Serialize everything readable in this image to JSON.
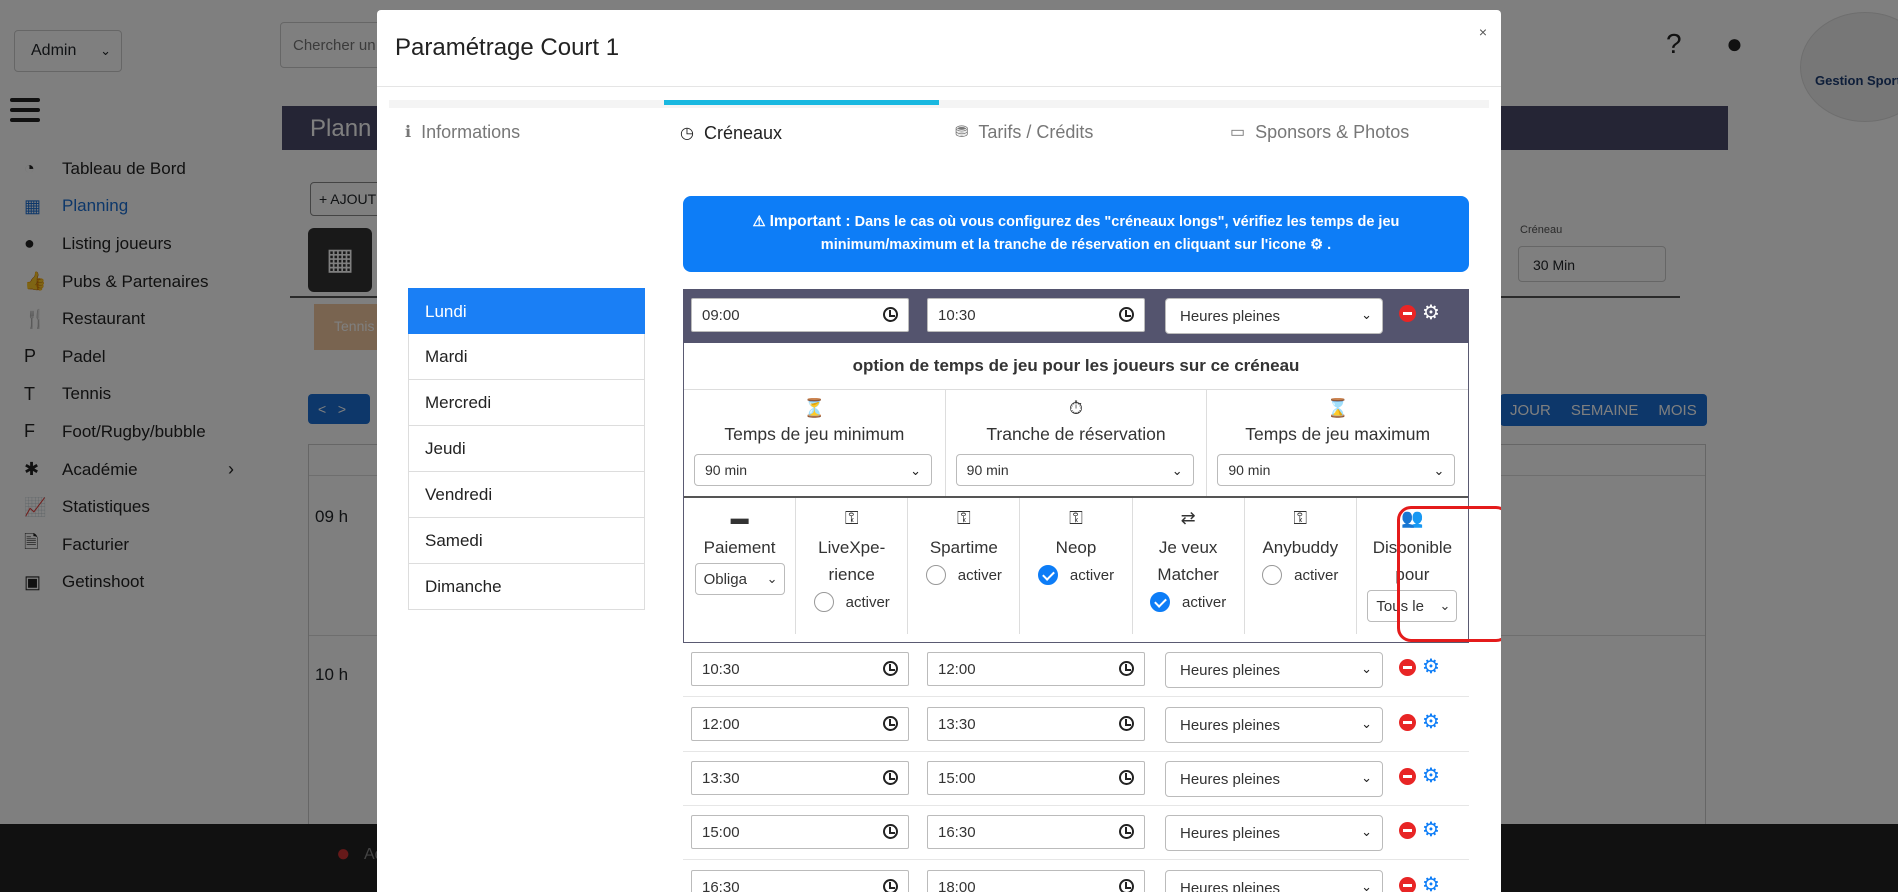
{
  "app": {
    "admin_select": "Admin",
    "search_placeholder": "Chercher un",
    "header_title": "Plann",
    "add_button": "+ AJOUT",
    "tennis_chip": "Tennis",
    "nav_prev": "<",
    "nav_next": ">",
    "views": [
      "JOUR",
      "SEMAINE",
      "MOIS"
    ],
    "creneau_label": "Créneau",
    "creneau_value": "30 Min",
    "hours": [
      "09 h",
      "10 h"
    ],
    "logo_text": "Gestion Sport",
    "bottom_user": "Ad",
    "sidebar": [
      {
        "label": "Tableau de Bord",
        "icon": "dashboard-icon",
        "glyph": "◔"
      },
      {
        "label": "Planning",
        "icon": "calendar-icon",
        "glyph": "▦",
        "active": true
      },
      {
        "label": "Listing joueurs",
        "icon": "user-icon",
        "glyph": "●"
      },
      {
        "label": "Pubs & Partenaires",
        "icon": "thumbs-up-icon",
        "glyph": "👍"
      },
      {
        "label": "Restaurant",
        "icon": "utensils-icon",
        "glyph": "🍴"
      },
      {
        "label": "Padel",
        "icon": "letter-p-icon",
        "glyph": "P"
      },
      {
        "label": "Tennis",
        "icon": "letter-t-icon",
        "glyph": "T"
      },
      {
        "label": "Foot/Rugby/bubble",
        "icon": "letter-f-icon",
        "glyph": "F"
      },
      {
        "label": "Académie",
        "icon": "child-icon",
        "glyph": "✱"
      },
      {
        "label": "Statistiques",
        "icon": "chart-line-icon",
        "glyph": "📈"
      },
      {
        "label": "Facturier",
        "icon": "invoice-icon",
        "glyph": "🗎"
      },
      {
        "label": "Getinshoot",
        "icon": "photos-icon",
        "glyph": "▣"
      }
    ]
  },
  "modal": {
    "title": "Paramétrage Court 1",
    "close": "×",
    "tabs": [
      {
        "label": "Informations",
        "icon": "info-circle-icon",
        "glyph": "ℹ"
      },
      {
        "label": "Créneaux",
        "icon": "clock-icon",
        "glyph": "◷"
      },
      {
        "label": "Tarifs / Crédits",
        "icon": "coins-icon",
        "glyph": "⛃"
      },
      {
        "label": "Sponsors & Photos",
        "icon": "images-icon",
        "glyph": "▭"
      }
    ],
    "days": [
      "Lundi",
      "Mardi",
      "Mercredi",
      "Jeudi",
      "Vendredi",
      "Samedi",
      "Dimanche"
    ],
    "alert": {
      "label": "Important :",
      "text": "Dans le cas où vous configurez des \"créneaux longs\", vérifiez les temps de jeu minimum/maximum et la tranche de réservation en cliquant sur l'icone",
      "end": "."
    },
    "slots": [
      {
        "start": "09:00",
        "end": "10:30",
        "mode": "Heures pleines"
      },
      {
        "start": "10:30",
        "end": "12:00",
        "mode": "Heures pleines"
      },
      {
        "start": "12:00",
        "end": "13:30",
        "mode": "Heures pleines"
      },
      {
        "start": "13:30",
        "end": "15:00",
        "mode": "Heures pleines"
      },
      {
        "start": "15:00",
        "end": "16:30",
        "mode": "Heures pleines"
      },
      {
        "start": "16:30",
        "end": "18:00",
        "mode": "Heures pleines"
      }
    ],
    "options_title": "option de temps de jeu pour les joueurs sur ce créneau",
    "durations": [
      {
        "label": "Temps de jeu minimum",
        "value": "90 min",
        "icon": "hourglass-icon",
        "glyph": "⏳"
      },
      {
        "label": "Tranche de réservation",
        "value": "90 min",
        "icon": "stopwatch-icon",
        "glyph": "⏱"
      },
      {
        "label": "Temps de jeu maximum",
        "value": "90 min",
        "icon": "hourglass-end-icon",
        "glyph": "⌛"
      }
    ],
    "integrations": [
      {
        "label": "Paiement",
        "type": "select",
        "value": "Obliga",
        "icon": "credit-card-icon",
        "glyph": "▬"
      },
      {
        "label": "LiveXpe-rience",
        "type": "radio",
        "radio_label": "activer",
        "checked": false,
        "icon": "key-icon",
        "glyph": "⚿"
      },
      {
        "label": "Spartime",
        "type": "radio",
        "radio_label": "activer",
        "checked": false,
        "icon": "key-icon",
        "glyph": "⚿"
      },
      {
        "label": "Neop",
        "type": "radio",
        "radio_label": "activer",
        "checked": true,
        "icon": "key-icon",
        "glyph": "⚿"
      },
      {
        "label": "Je veux Matcher",
        "type": "radio",
        "radio_label": "activer",
        "checked": true,
        "icon": "people-arrows-icon",
        "glyph": "⇄"
      },
      {
        "label": "Anybuddy",
        "type": "radio",
        "radio_label": "activer",
        "checked": false,
        "icon": "key-icon",
        "glyph": "⚿"
      },
      {
        "label": "Disponible pour",
        "type": "select",
        "value": "Tous le",
        "icon": "users-icon",
        "glyph": "👥"
      }
    ]
  }
}
